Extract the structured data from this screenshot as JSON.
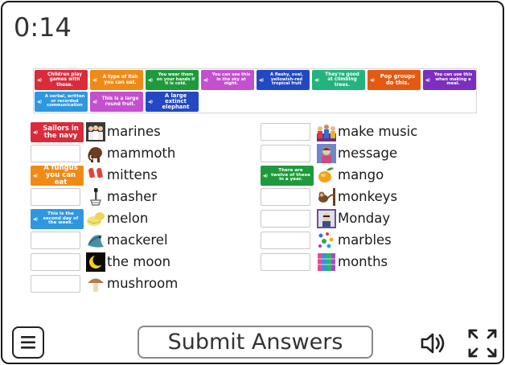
{
  "timer": "0:14",
  "bank_cards": [
    {
      "text": "Children play games with these.",
      "color": "#d92b3a"
    },
    {
      "text": "A type of fish you can eat.",
      "color": "#f08a16"
    },
    {
      "text": "You wear them on your hands if it is cold.",
      "color": "#1e9a3c"
    },
    {
      "text": "You can see this in the sky at night.",
      "color": "#c44fcf"
    },
    {
      "text": "A fleshy, oval, yellowish-red tropical fruit",
      "color": "#2348c4"
    },
    {
      "text": "They're good at climbing trees.",
      "color": "#23b37e"
    },
    {
      "text": "Pop groups do this.",
      "color": "#e35a10"
    },
    {
      "text": "You can use this when making a meal.",
      "color": "#7b2fbf"
    },
    {
      "text": "A verbal, written or recorded communication",
      "color": "#2f97e0"
    },
    {
      "text": "This is a large round fruit.",
      "color": "#c44fcf"
    },
    {
      "text": "A large extinct elephant",
      "color": "#2348c4"
    }
  ],
  "left_column": [
    {
      "word": "marines",
      "icon": "marines-icon",
      "placed": {
        "text": "Sailors in the navy",
        "color": "#d92b3a"
      }
    },
    {
      "word": "mammoth",
      "icon": "mammoth-icon"
    },
    {
      "word": "mittens",
      "icon": "mittens-icon",
      "placed": {
        "text": "A fungus you can eat",
        "color": "#f08a16"
      }
    },
    {
      "word": "masher",
      "icon": "masher-icon"
    },
    {
      "word": "melon",
      "icon": "melon-icon",
      "placed": {
        "text": "This is the second day of the week.",
        "color": "#2f97e0"
      }
    },
    {
      "word": "mackerel",
      "icon": "mackerel-icon"
    },
    {
      "word": "the moon",
      "icon": "moon-icon"
    },
    {
      "word": "mushroom",
      "icon": "mushroom-icon"
    }
  ],
  "right_column": [
    {
      "word": "make music",
      "icon": "band-icon"
    },
    {
      "word": "message",
      "icon": "message-icon"
    },
    {
      "word": "mango",
      "icon": "mango-icon",
      "placed": {
        "text": "There are twelve of these in a year.",
        "color": "#1e9a3c"
      }
    },
    {
      "word": "monkeys",
      "icon": "monkeys-icon"
    },
    {
      "word": "Monday",
      "icon": "monday-icon"
    },
    {
      "word": "marbles",
      "icon": "marbles-icon"
    },
    {
      "word": "months",
      "icon": "months-icon"
    }
  ],
  "toolbar": {
    "submit_label": "Submit Answers",
    "menu_icon": "menu-icon",
    "sound_icon": "speaker-icon",
    "fullscreen_icon": "fullscreen-icon"
  }
}
